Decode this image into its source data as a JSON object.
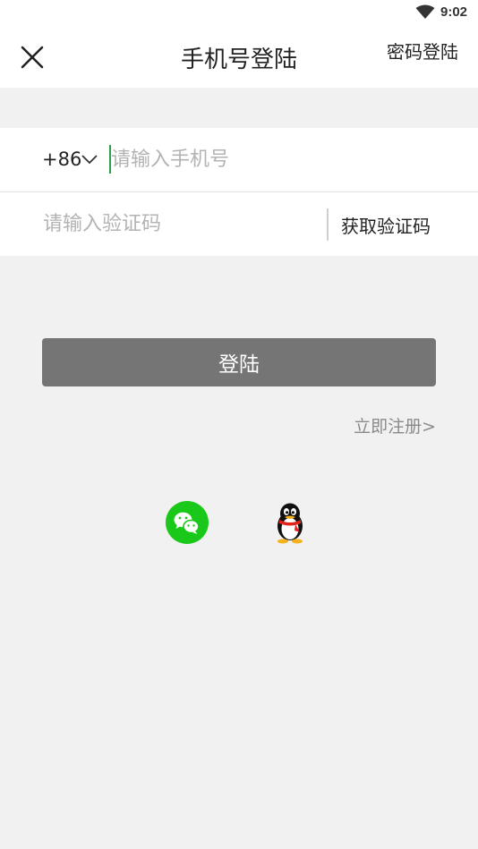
{
  "status_bar": {
    "time": "9:02",
    "wifi_icon": "wifi-icon"
  },
  "header": {
    "title": "手机号登陆",
    "close_icon": "close-icon",
    "password_login_label": "密码登陆"
  },
  "form": {
    "country_code": "+86",
    "country_chevron_icon": "chevron-down-icon",
    "phone_value": "",
    "phone_placeholder": "请输入手机号",
    "code_value": "",
    "code_placeholder": "请输入验证码",
    "get_code_label": "获取验证码"
  },
  "actions": {
    "login_label": "登陆",
    "register_label": "立即注册>"
  },
  "social": {
    "items": [
      {
        "icon": "wechat-icon",
        "color": "#1ac81a"
      },
      {
        "icon": "qq-icon",
        "color": "#000000"
      }
    ]
  },
  "colors": {
    "accent_caret": "#2aa04a",
    "button_bg": "#757575",
    "page_bg": "#f1f1f1"
  }
}
